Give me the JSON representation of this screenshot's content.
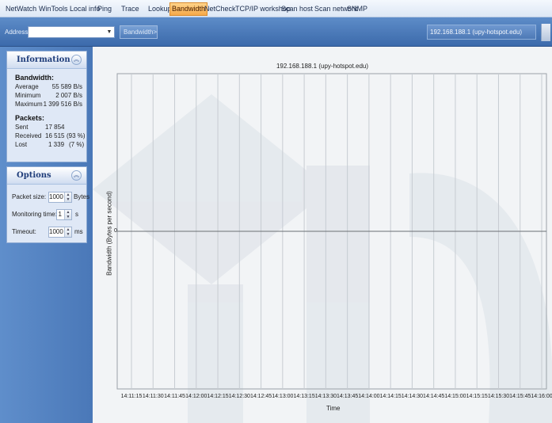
{
  "menu": {
    "items": [
      "NetWatch",
      "WinTools",
      "Local info",
      "Ping",
      "Trace",
      "Lookup",
      "Bandwidth",
      "NetCheck",
      "TCP/IP workshop",
      "Scan host",
      "Scan network",
      "SNMP"
    ],
    "active": "Bandwidth"
  },
  "toolbar": {
    "address_label": "Address:",
    "address_value": "",
    "button_label": "Bandwidth>",
    "host": "192.168.188.1 (upy-hotspot.edu)"
  },
  "information": {
    "title": "Information",
    "bandwidth_title": "Bandwidth:",
    "average_label": "Average",
    "average_value": "55 589 B/s",
    "minimum_label": "Minimum",
    "minimum_value": "2 007 B/s",
    "maximum_label": "Maximum",
    "maximum_value": "1 399 516 B/s",
    "packets_title": "Packets:",
    "sent_label": "Sent",
    "sent_value": "17 854",
    "received_label": "Received",
    "received_value": "16 515",
    "received_pct": "(93 %)",
    "lost_label": "Lost",
    "lost_value": "1 339",
    "lost_pct": "(7 %)"
  },
  "options": {
    "title": "Options",
    "packet_size_label": "Packet size:",
    "packet_size_value": "1000",
    "packet_size_unit": "Bytes",
    "monitoring_time_label": "Monitoring time:",
    "monitoring_time_value": "1",
    "monitoring_time_unit": "s",
    "timeout_label": "Timeout:",
    "timeout_value": "1000",
    "timeout_unit": "ms"
  },
  "chart_data": {
    "type": "line",
    "title": "192.168.188.1 (upy-hotspot.edu)",
    "xlabel": "Time",
    "ylabel": "Bandwidth (Bytes per second)",
    "y_ticks": [
      "0"
    ],
    "x_ticks": [
      "14:11:15",
      "14:11:30",
      "14:11:45",
      "14:12:00",
      "14:12:15",
      "14:12:30",
      "14:12:45",
      "14:13:00",
      "14:13:15",
      "14:13:30",
      "14:13:45",
      "14:14:00",
      "14:14:15",
      "14:14:30",
      "14:14:45",
      "14:15:00",
      "14:15:15",
      "14:15:30",
      "14:15:45",
      "14:16:00"
    ],
    "series": [],
    "grid": true
  }
}
